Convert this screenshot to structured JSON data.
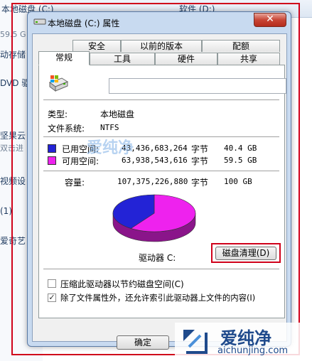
{
  "background": {
    "column1_header": "本地磁盘 (C:)",
    "column2_header": "软件 (D:)",
    "left_items": [
      "59.5 G",
      "动存储",
      "DVD 驱",
      "坚果云",
      "双击进",
      "视频设",
      "(1)",
      "爱奇艺"
    ]
  },
  "dialog": {
    "title": "本地磁盘 (C:) 属性",
    "close_glyph": "✕",
    "tabs_row1": [
      "安全",
      "以前的版本",
      "配额"
    ],
    "tabs_row2": [
      "常规",
      "工具",
      "硬件",
      "共享"
    ],
    "active_tab": "常规",
    "general": {
      "name_value": "",
      "type_label": "类型:",
      "type_value": "本地磁盘",
      "fs_label": "文件系统:",
      "fs_value": "NTFS",
      "used_label": "已用空间:",
      "used_bytes": "43,436,683,264",
      "used_unit": "字节",
      "used_gb": "40.4 GB",
      "free_label": "可用空间:",
      "free_bytes": "63,938,543,616",
      "free_unit": "字节",
      "free_gb": "59.5 GB",
      "capacity_label": "容量:",
      "capacity_bytes": "107,375,226,880",
      "capacity_unit": "字节",
      "capacity_gb": "100 GB",
      "drive_label": "驱动器 C:",
      "cleanup_button": "磁盘清理(D)",
      "compress_label": "压缩此驱动器以节约磁盘空间(C)",
      "compress_checked": false,
      "index_label": "除了文件属性外，还允许索引此驱动器上文件的内容(I)",
      "index_checked": true,
      "ok_button": "确定"
    },
    "chart": {
      "used_fraction": 0.4045,
      "used_color": "#2323d6",
      "free_color": "#ee22ee"
    }
  },
  "watermark": {
    "brand": "爱纯净",
    "url": "aichunjing.com",
    "center": "爱纯净"
  },
  "colors": {
    "annotation_red": "#d0021b"
  }
}
